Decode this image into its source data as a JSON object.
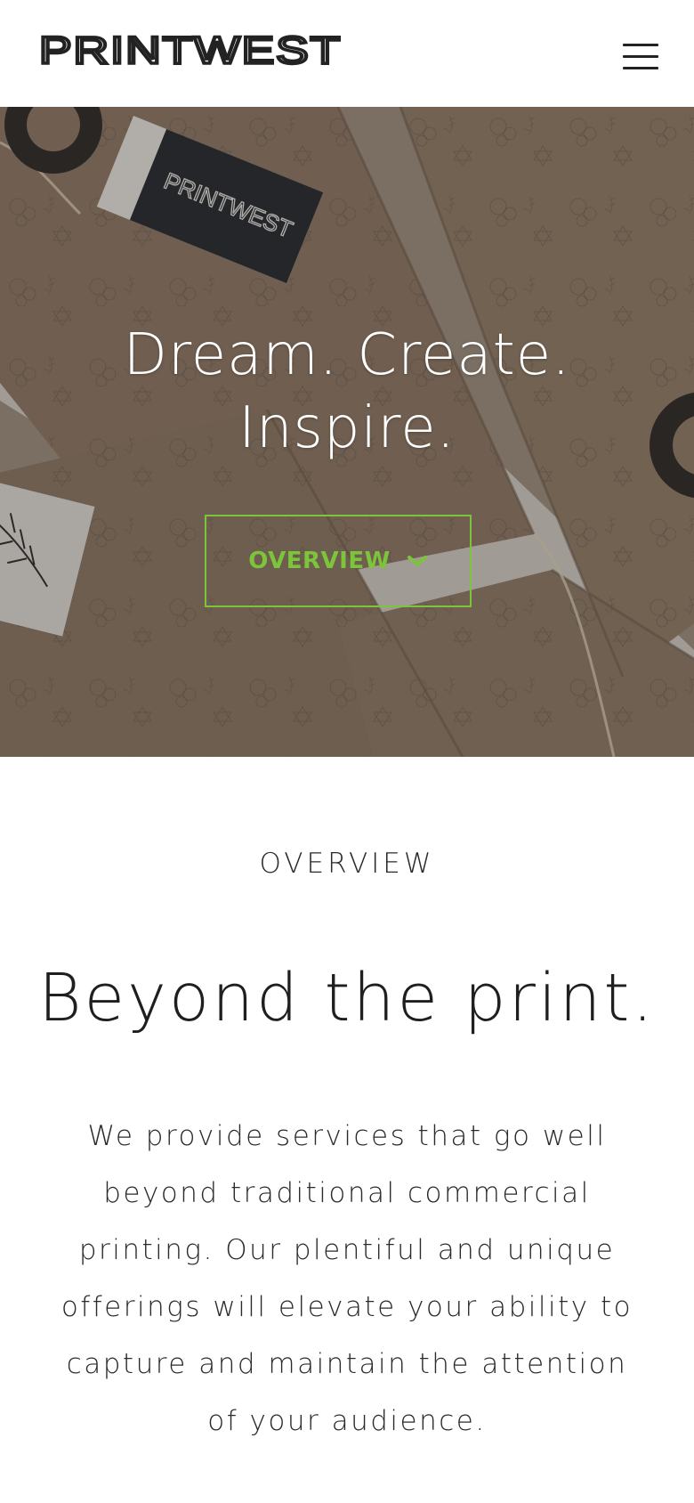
{
  "header": {
    "logo_text": "PRINTWEST",
    "menu_icon": "hamburger-menu-icon"
  },
  "hero": {
    "title_line1": "Dream. Create.",
    "title_line2": "Inspire.",
    "background_image": "brown kraft envelopes with botanical prints and PRINTWEST tags",
    "tag_text": "PRINTWEST",
    "cta": {
      "label": "OVERVIEW",
      "icon": "chevron-down-icon"
    }
  },
  "overview": {
    "kicker": "OVERVIEW",
    "heading": "Beyond the print.",
    "body": "We provide services that go well beyond traditional commercial printing. Our plentiful and unique offerings will elevate your ability to capture and maintain the attention of your audience."
  },
  "colors": {
    "accent": "#7cc53b",
    "text": "#222222",
    "background": "#ffffff"
  }
}
